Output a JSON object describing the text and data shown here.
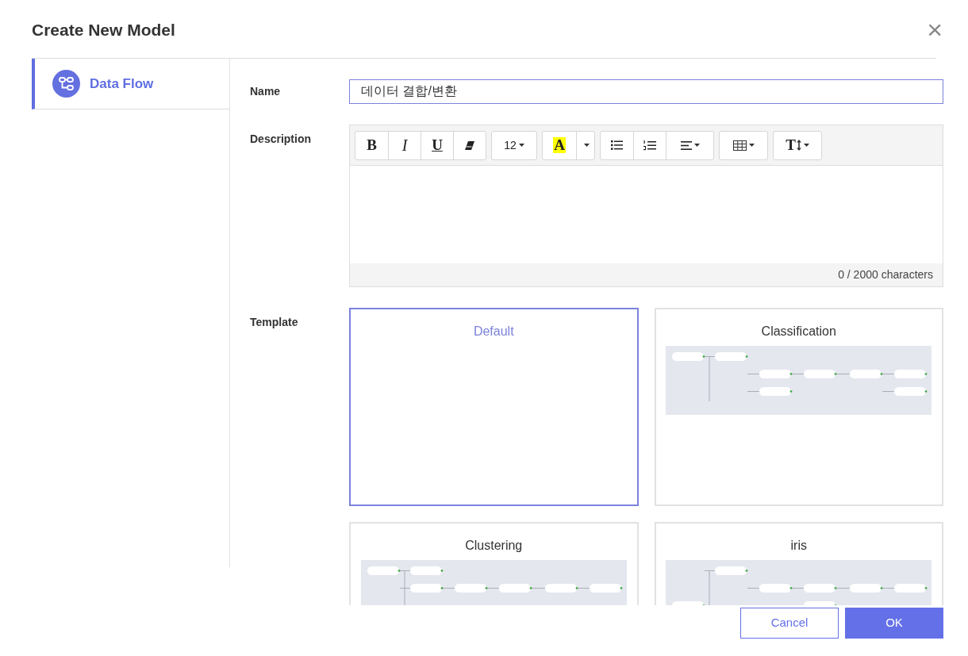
{
  "dialog": {
    "title": "Create New Model",
    "close": "×"
  },
  "sidebar": {
    "items": [
      {
        "label": "Data Flow",
        "selected": true
      }
    ]
  },
  "form": {
    "name": {
      "label": "Name",
      "value": "데이터 결합/변환"
    },
    "description": {
      "label": "Description",
      "toolbar": [
        [
          {
            "kind": "bold",
            "label": "B"
          },
          {
            "kind": "italic",
            "label": "I"
          },
          {
            "kind": "underline",
            "label": "U"
          },
          {
            "kind": "eraser"
          }
        ],
        [
          {
            "kind": "fontsize",
            "label": "12"
          }
        ],
        [
          {
            "kind": "highlight",
            "label": "A"
          },
          {
            "kind": "caret"
          }
        ],
        [
          {
            "kind": "bullets"
          },
          {
            "kind": "numbers"
          },
          {
            "kind": "align"
          }
        ],
        [
          {
            "kind": "table"
          }
        ],
        [
          {
            "kind": "lineheight",
            "label": "T"
          }
        ]
      ],
      "counter": "0 / 2000 characters"
    },
    "template": {
      "label": "Template",
      "options": [
        {
          "name": "Default",
          "selected": true,
          "kind": "empty"
        },
        {
          "name": "Classification",
          "selected": false,
          "kind": "preview"
        },
        {
          "name": "Clustering",
          "selected": false,
          "kind": "preview"
        },
        {
          "name": "iris",
          "selected": false,
          "kind": "preview"
        }
      ]
    }
  },
  "buttons": [
    {
      "label": "Cancel",
      "kind": "secondary"
    },
    {
      "label": "OK",
      "kind": "primary"
    }
  ]
}
